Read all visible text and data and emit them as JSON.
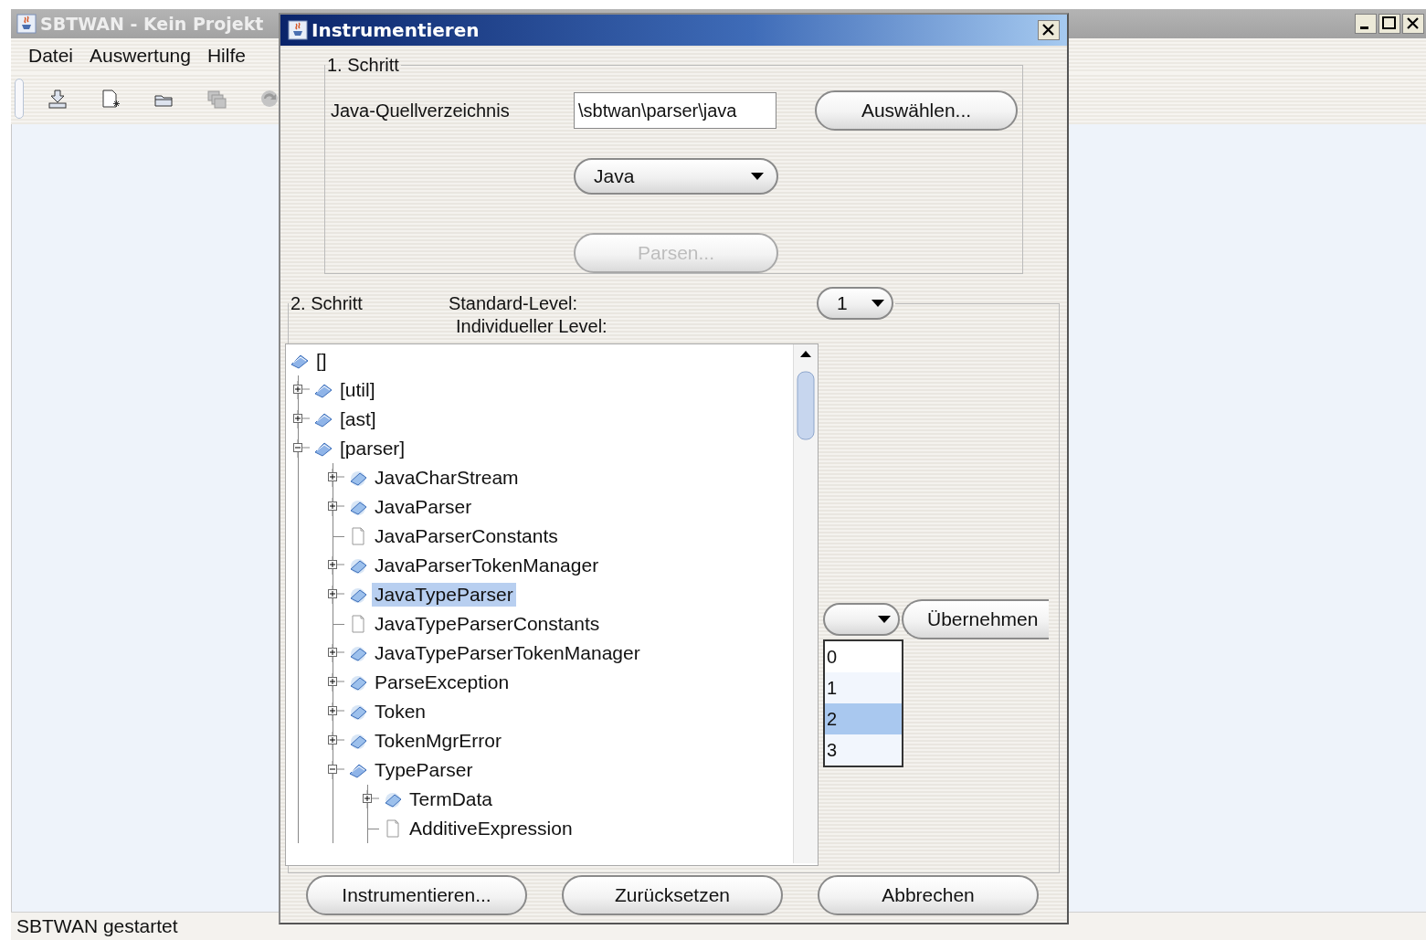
{
  "main_window": {
    "title": "SBTWAN - Kein Projekt",
    "menu": [
      "Datei",
      "Auswertung",
      "Hilfe"
    ],
    "toolbar": [
      {
        "kind": "import",
        "disabled": false
      },
      {
        "kind": "new",
        "disabled": false
      },
      {
        "kind": "open",
        "disabled": false
      },
      {
        "kind": "stack",
        "disabled": true
      },
      {
        "kind": "refresh",
        "disabled": true
      }
    ],
    "status_bar": "SBTWAN gestartet"
  },
  "dialog": {
    "title": "Instrumentieren",
    "step1": {
      "legend": "1. Schritt",
      "source_label": "Java-Quellverzeichnis",
      "source_value": "\\sbtwan\\parser\\java",
      "browse_button": "Auswählen...",
      "language": "Java",
      "parse_button": {
        "label": "Parsen...",
        "disabled": true
      }
    },
    "step2": {
      "legend": "2. Schritt",
      "standard_level_label": "Standard-Level:",
      "standard_level": "1",
      "individual_level_label": "Individueller Level:",
      "tree": [
        {
          "label": "[]",
          "kind": "package",
          "selected": false,
          "children": [
            {
              "label": "[util]",
              "kind": "package",
              "expanded": false,
              "selected": false
            },
            {
              "label": "[ast]",
              "kind": "package",
              "expanded": false,
              "selected": false
            },
            {
              "label": "[parser]",
              "kind": "package",
              "expanded": true,
              "selected": false,
              "children": [
                {
                  "label": "JavaCharStream",
                  "kind": "class",
                  "expanded": false,
                  "selected": false
                },
                {
                  "label": "JavaParser",
                  "kind": "class",
                  "expanded": false,
                  "selected": false
                },
                {
                  "label": "JavaParserConstants",
                  "kind": "file",
                  "selected": false
                },
                {
                  "label": "JavaParserTokenManager",
                  "kind": "class",
                  "expanded": false,
                  "selected": false
                },
                {
                  "label": "JavaTypeParser",
                  "kind": "class",
                  "expanded": false,
                  "selected": true
                },
                {
                  "label": "JavaTypeParserConstants",
                  "kind": "file",
                  "selected": false
                },
                {
                  "label": "JavaTypeParserTokenManager",
                  "kind": "class",
                  "expanded": false,
                  "selected": false
                },
                {
                  "label": "ParseException",
                  "kind": "class",
                  "expanded": false,
                  "selected": false
                },
                {
                  "label": "Token",
                  "kind": "class",
                  "expanded": false,
                  "selected": false
                },
                {
                  "label": "TokenMgrError",
                  "kind": "class",
                  "expanded": false,
                  "selected": false
                },
                {
                  "label": "TypeParser",
                  "kind": "package",
                  "expanded": true,
                  "selected": false,
                  "children": [
                    {
                      "label": "TermData",
                      "kind": "class",
                      "expanded": false,
                      "selected": false
                    },
                    {
                      "label": "AdditiveExpression",
                      "kind": "file",
                      "selected": false
                    }
                  ]
                }
              ]
            }
          ]
        }
      ],
      "level_list": [
        {
          "label": "0",
          "selected": false
        },
        {
          "label": "1",
          "selected": false
        },
        {
          "label": "2",
          "selected": true
        },
        {
          "label": "3",
          "selected": false
        }
      ],
      "apply_button": "Übernehmen"
    },
    "buttons": [
      "Instrumentieren...",
      "Zurücksetzen",
      "Abbrechen"
    ]
  }
}
